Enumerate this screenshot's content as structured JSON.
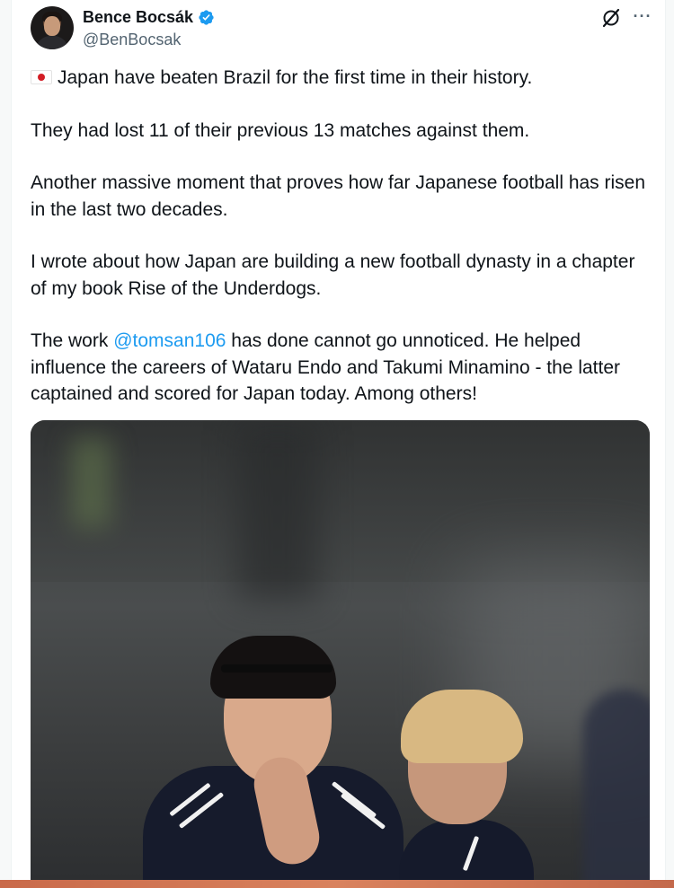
{
  "author": {
    "display_name": "Bence Bocsák",
    "handle": "@BenBocsak",
    "verified_color": "#1d9bf0"
  },
  "actions": {
    "grok_icon": "grok-icon",
    "more_label": "···"
  },
  "tweet": {
    "p1": "Japan have beaten Brazil for the first time in their history.",
    "p2": "They had lost 11 of their previous 13 matches against them.",
    "p3": "Another massive moment that proves how far Japanese football has risen in the last two decades.",
    "p4": "I wrote about how Japan are building a new football dynasty in a chapter of my book Rise of the Underdogs.",
    "p5_before": "The work ",
    "p5_mention": "@tomsan106",
    "p5_after": " has done cannot go unnoticed. He helped influence the careers of Wataru Endo and Takumi Minamino - the latter captained and scored for Japan today. Among others!"
  },
  "colors": {
    "text": "#0f1419",
    "secondary": "#536471",
    "link": "#1d9bf0"
  }
}
